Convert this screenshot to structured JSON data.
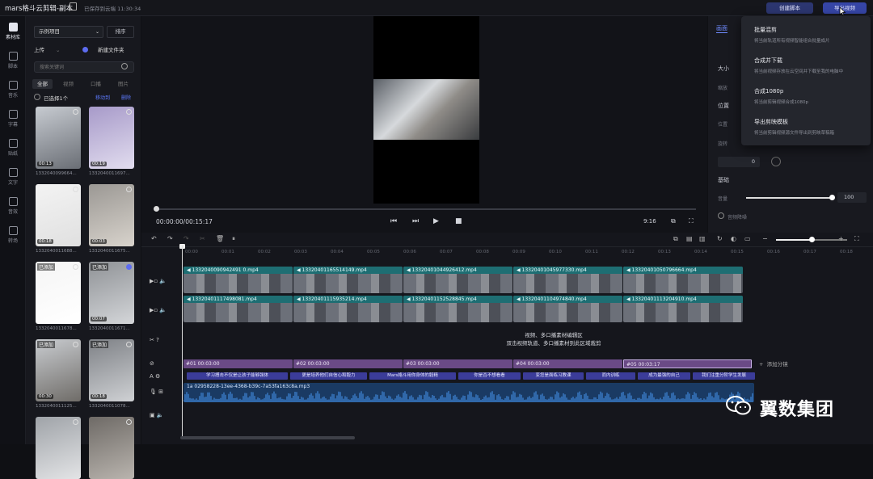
{
  "topbar": {
    "title": "mars格斗云剪辑-副本",
    "save_status": "已保存到云端 11:30:34",
    "create_script": "创建脚本",
    "export": "导出视频"
  },
  "nav": [
    {
      "label": "素材库"
    },
    {
      "label": "脚本"
    },
    {
      "label": "音乐"
    },
    {
      "label": "字幕"
    },
    {
      "label": "贴纸"
    },
    {
      "label": "文字"
    },
    {
      "label": "音效"
    },
    {
      "label": "转场"
    }
  ],
  "media": {
    "project_select": "示例项目",
    "sort": "排序",
    "upload": "上传",
    "new_folder": "新建文件夹",
    "search_placeholder": "搜索关键词",
    "filters": [
      "全部",
      "视频",
      "口播",
      "图片"
    ],
    "selected_count": "已选择1个",
    "cancel": "移动到",
    "delete": "删除",
    "thumbs": [
      {
        "dur": "00:13",
        "name": "1332040099664...",
        "added": "",
        "c1": "#c7cbd1",
        "c2": "#6a6e75"
      },
      {
        "dur": "00:19",
        "name": "1332040011697...",
        "added": "",
        "c1": "#a79ac9",
        "c2": "#e2ddef"
      },
      {
        "dur": "00:18",
        "name": "1332040011688...",
        "added": "",
        "c1": "#f3f3f3",
        "c2": "#e0e0e0"
      },
      {
        "dur": "00:03",
        "name": "1332040011675...",
        "added": "",
        "c1": "#9b9894",
        "c2": "#d8d3cc"
      },
      {
        "dur": "",
        "name": "1332040011678...",
        "added": "已添加",
        "c1": "#f5f5f5",
        "c2": "#ffffff"
      },
      {
        "dur": "00:07",
        "name": "1332040011671...",
        "added": "已添加",
        "c1": "#8f9296",
        "c2": "#d4d6d9"
      },
      {
        "dur": "00:30",
        "name": "1332040011125...",
        "added": "已添加",
        "c1": "#c9ccd0",
        "c2": "#6f6c68"
      },
      {
        "dur": "00:18",
        "name": "1332040011078...",
        "added": "已添加",
        "c1": "#7e8186",
        "c2": "#cfd1d4"
      },
      {
        "dur": "",
        "name": "",
        "added": "",
        "c1": "#9fa3a8",
        "c2": "#e3e4e6"
      },
      {
        "dur": "",
        "name": "",
        "added": "",
        "c1": "#6e6a66",
        "c2": "#b9b4ae"
      }
    ]
  },
  "preview": {
    "time": "00:00:00/00:15:17",
    "aspect": "9:16"
  },
  "right_panel": {
    "tab": "画面",
    "size": "大小",
    "scale": "缩放",
    "position": "位置",
    "pos_sub": "位置",
    "rotate": "旋转",
    "rotate_value": "0",
    "basic": "基础",
    "volume": "音量",
    "volume_value": "100",
    "denoise": "音频降噪"
  },
  "export_menu": [
    {
      "title": "批量混剪",
      "desc": "将当前轨道所有视频智能组合批量成片"
    },
    {
      "title": "合成并下载",
      "desc": "将当前视频存放在云空间并下载至我的电脑中"
    },
    {
      "title": "合成1080p",
      "desc": "将当前剪辑视频合成1080p"
    },
    {
      "title": "导出剪映模板",
      "desc": "将当前剪辑视频源文件导出到剪映草稿箱"
    }
  ],
  "timeline": {
    "ticks": [
      "00:00",
      "00:01",
      "00:02",
      "00:03",
      "00:04",
      "00:05",
      "00:06",
      "00:07",
      "00:08",
      "00:09",
      "00:10",
      "00:11",
      "00:12",
      "00:13",
      "00:14",
      "00:15",
      "00:16",
      "00:17",
      "00:18"
    ],
    "track1": [
      "1332040090942491 0.mp4",
      "13320401165514149.mp4",
      "13320401044926412.mp4",
      "13320401045977330.mp4",
      "13320401050796664.mp4"
    ],
    "track2": [
      "13320401117498081.mp4",
      "13320401115935214.mp4",
      "13320401152528845.mp4",
      "13320401104974840.mp4",
      "13320401113204910.mp4"
    ],
    "hint1": "视频、多口播素材编辑区",
    "hint2": "双击视频轨道、多口播素材到此区域裁剪",
    "segments": [
      "#01 00:03:00",
      "#02 00:03:00",
      "#03 00:03:00",
      "#04 00:03:00",
      "#05 00:03:17"
    ],
    "add_segment": "添加分镜",
    "subtitles": [
      "学习搏击不仅是让孩子能够强体",
      "更是培养他们自信心和毅力",
      "Mars格斗用你身体的毅精",
      "你是否不想看看",
      "变您是面练习教课",
      "而内训练",
      "成为最强的自己",
      "我们注重分阶学生发展"
    ],
    "audio": "1a 02958228-13ee-4368-b39c-7a53fa163c8a.mp3"
  },
  "watermark": {
    "text": "翼数集团"
  }
}
